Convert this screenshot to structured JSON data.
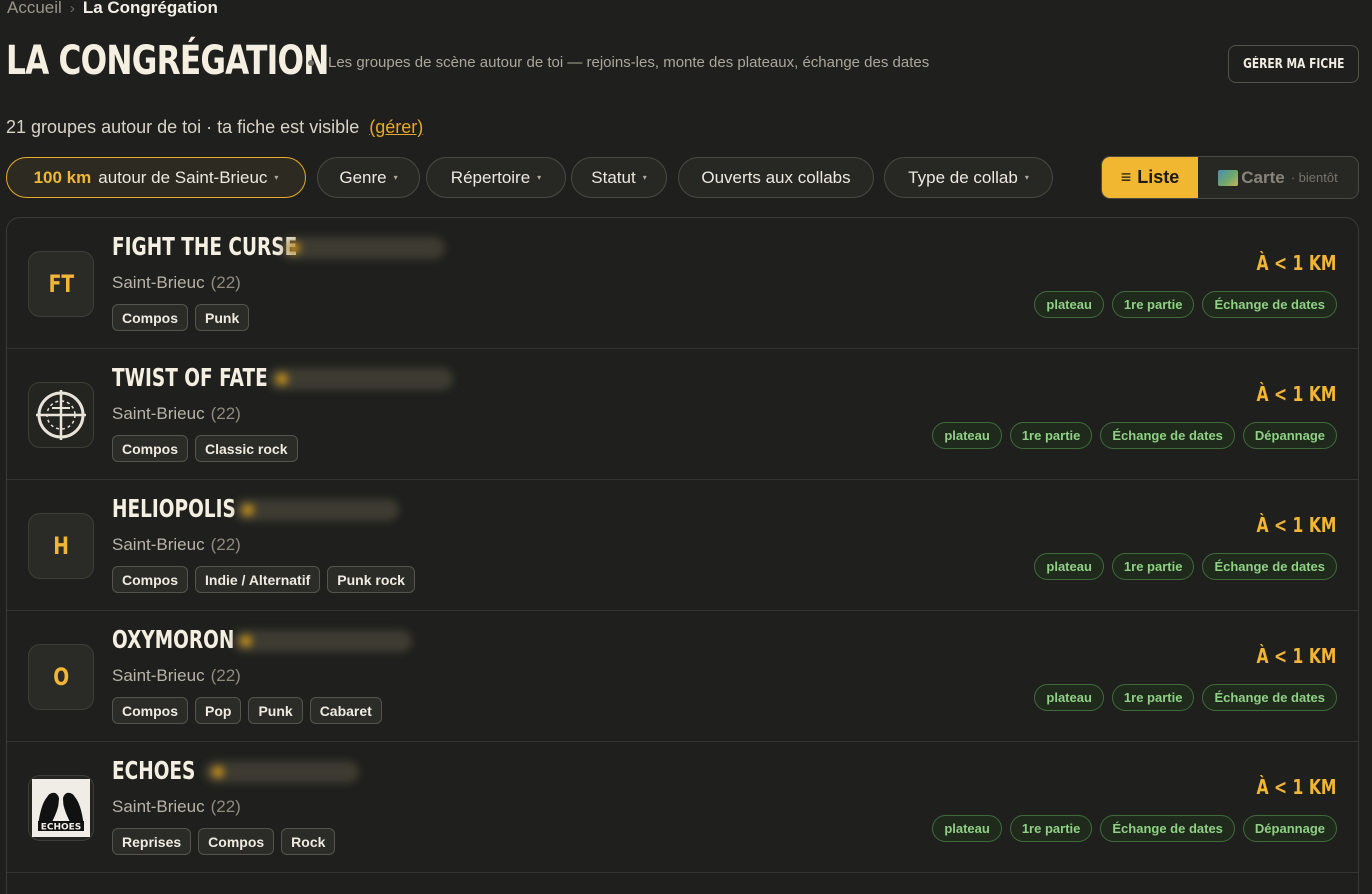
{
  "breadcrumb": {
    "home": "Accueil",
    "separator": "›",
    "current": "La Congrégation"
  },
  "header": {
    "title": "LA CONGRÉGATION",
    "subtitle": "Les groupes de scène autour de toi — rejoins-les, monte des plateaux, échange des dates",
    "manage_button": "GÉRER MA FICHE"
  },
  "summary": {
    "text": "21 groupes autour de toi · ta fiche est visible",
    "manage_link": "(gérer)"
  },
  "filters": {
    "radius_km": "100 km",
    "radius_label": "autour de Saint-Brieuc",
    "caret": "▾",
    "genre": "Genre",
    "repertoire": "Répertoire",
    "status": "Statut",
    "open_collabs": "Ouverts aux collabs",
    "collab_type": "Type de collab"
  },
  "view_toggle": {
    "list_icon": "≡",
    "list_label": "Liste",
    "map_label": "Carte",
    "map_soon": "· bientôt"
  },
  "colors": {
    "accent": "#f2b534",
    "collab_green": "#8fd084",
    "background": "#1f201d"
  },
  "bands": [
    {
      "initials": "FT",
      "avatar": "initials",
      "name": "FIGHT THE CURSE",
      "city": "Saint-Brieuc",
      "dept": "(22)",
      "tags": [
        "Compos",
        "Punk"
      ],
      "distance": "À < 1 KM",
      "collabs": [
        "plateau",
        "1re partie",
        "Échange de dates"
      ]
    },
    {
      "initials": "",
      "avatar": "crosshair-logo",
      "name": "TWIST OF FATE",
      "city": "Saint-Brieuc",
      "dept": "(22)",
      "tags": [
        "Compos",
        "Classic rock"
      ],
      "distance": "À < 1 KM",
      "collabs": [
        "plateau",
        "1re partie",
        "Échange de dates",
        "Dépannage"
      ]
    },
    {
      "initials": "H",
      "avatar": "initials",
      "name": "HELIOPOLIS",
      "city": "Saint-Brieuc",
      "dept": "(22)",
      "tags": [
        "Compos",
        "Indie / Alternatif",
        "Punk rock"
      ],
      "distance": "À < 1 KM",
      "collabs": [
        "plateau",
        "1re partie",
        "Échange de dates"
      ]
    },
    {
      "initials": "O",
      "avatar": "initials",
      "name": "OXYMORON",
      "city": "Saint-Brieuc",
      "dept": "(22)",
      "tags": [
        "Compos",
        "Pop",
        "Punk",
        "Cabaret"
      ],
      "distance": "À < 1 KM",
      "collabs": [
        "plateau",
        "1re partie",
        "Échange de dates"
      ]
    },
    {
      "initials": "",
      "avatar": "echoes-logo",
      "name": "ECHOES",
      "city": "Saint-Brieuc",
      "dept": "(22)",
      "tags": [
        "Reprises",
        "Compos",
        "Rock"
      ],
      "distance": "À < 1 KM",
      "collabs": [
        "plateau",
        "1re partie",
        "Échange de dates",
        "Dépannage"
      ]
    }
  ]
}
